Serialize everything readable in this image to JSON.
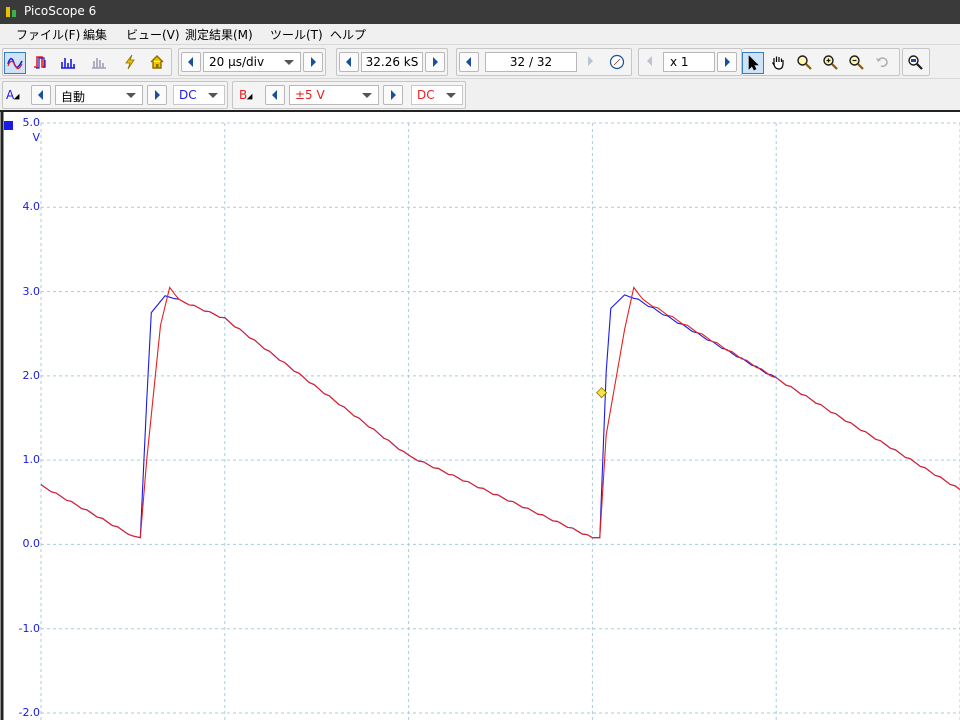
{
  "window": {
    "title": "PicoScope 6"
  },
  "menu": {
    "items": [
      "ファイル(F)",
      "編集",
      "ビュー(V)",
      "測定結果(M)",
      "ツール(T)",
      "ヘルプ"
    ]
  },
  "toolbar": {
    "timebase": "20 µs/div",
    "samples": "32.26 kS",
    "buffer": "32 / 32",
    "zoom_factor": "x 1"
  },
  "channels": {
    "a": {
      "label": "A",
      "range": "自動",
      "coupling": "DC",
      "color": "#1a1ae6"
    },
    "b": {
      "label": "B",
      "range": "±5 V",
      "coupling": "DC",
      "color": "#e62020"
    }
  },
  "chart_data": {
    "type": "line",
    "y_unit": "V",
    "ylim": [
      -2.0,
      5.0
    ],
    "y_ticks": [
      "5.0",
      "4.0",
      "3.0",
      "2.0",
      "1.0",
      "0.0",
      "-1.0",
      "-2.0"
    ],
    "grid": true,
    "x_divisions": 10,
    "x_units": "div",
    "series": [
      {
        "channel": "A",
        "color": "#1a1ae6",
        "x": [
          0,
          1.0,
          1.08,
          1.15,
          1.2,
          1.35,
          1.5,
          2.0,
          4.0,
          6.0,
          6.08,
          6.15,
          6.2,
          6.35,
          6.5,
          8.0,
          10.0
        ],
        "y": [
          0.7,
          0.1,
          0.08,
          1.7,
          2.75,
          2.95,
          2.9,
          2.68,
          1.05,
          0.08,
          0.08,
          2.05,
          2.8,
          2.96,
          2.9,
          1.97,
          0.65
        ]
      },
      {
        "channel": "B",
        "color": "#e62020",
        "x": [
          0,
          1.0,
          1.08,
          1.15,
          1.3,
          1.4,
          1.5,
          2.0,
          4.0,
          6.0,
          6.08,
          6.15,
          6.35,
          6.45,
          6.55,
          8.0,
          10.0
        ],
        "y": [
          0.7,
          0.1,
          0.08,
          1.0,
          2.6,
          3.05,
          2.9,
          2.68,
          1.05,
          0.08,
          0.08,
          1.3,
          2.55,
          3.05,
          2.9,
          1.97,
          0.65
        ]
      }
    ],
    "trigger_marker": {
      "x": 6.1,
      "y": 1.8
    }
  }
}
